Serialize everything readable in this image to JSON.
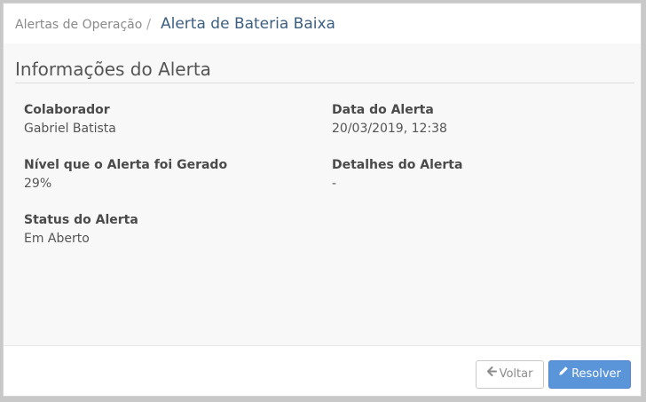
{
  "breadcrumb": {
    "parent_label": "Alertas de Operação",
    "separator": "/",
    "current_label": "Alerta de Bateria Baixa"
  },
  "section": {
    "title": "Informações do Alerta"
  },
  "fields": {
    "colaborador": {
      "label": "Colaborador",
      "value": "Gabriel Batista"
    },
    "data_alerta": {
      "label": "Data do Alerta",
      "value": "20/03/2019, 12:38"
    },
    "nivel": {
      "label": "Nível que o Alerta foi Gerado",
      "value": "29%"
    },
    "detalhes": {
      "label": "Detalhes do Alerta",
      "value": "-"
    },
    "status": {
      "label": "Status do Alerta",
      "value": "Em Aberto"
    }
  },
  "footer": {
    "back_label": "Voltar",
    "back_icon": "arrow-left-icon",
    "resolve_label": "Resolver",
    "resolve_icon": "pencil-icon"
  },
  "colors": {
    "primary": "#5b95d9",
    "breadcrumb_current": "#3c5f80"
  }
}
